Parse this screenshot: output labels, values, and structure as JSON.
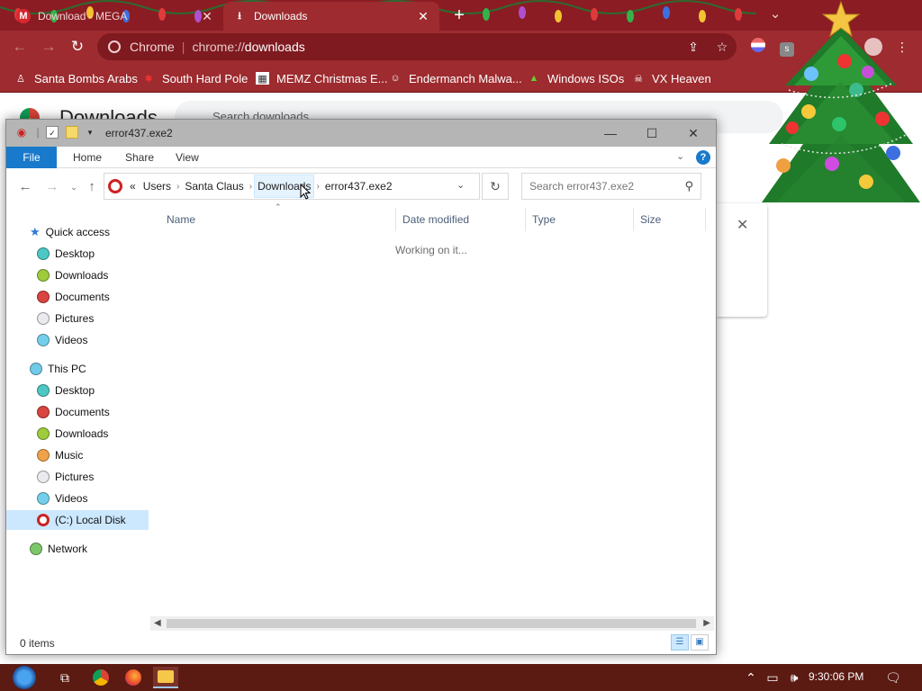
{
  "chrome": {
    "tabs": [
      {
        "title": "Download - MEGA",
        "favicon": "M",
        "close": "✕"
      },
      {
        "title": "Downloads",
        "favicon": "⭳",
        "close": "✕"
      }
    ],
    "new_tab": "+",
    "address": {
      "label": "Chrome",
      "separator": "|",
      "url_prefix": "chrome://",
      "url_main": "downloads"
    },
    "bookmarks": [
      "Santa Bombs Arabs",
      "South Hard Pole",
      "MEMZ Christmas E...",
      "Endermanch Malwa...",
      "Windows ISOs",
      "VX Heaven"
    ],
    "page_title": "Downloads",
    "search_placeholder": "Search downloads"
  },
  "explorer": {
    "title": "error437.exe2",
    "ribbon_tabs": [
      "File",
      "Home",
      "Share",
      "View"
    ],
    "breadcrumb": {
      "overflow": "«",
      "items": [
        "Users",
        "Santa Claus",
        "Downloads",
        "error437.exe2"
      ]
    },
    "search_placeholder": "Search error437.exe2",
    "columns": [
      "Name",
      "Date modified",
      "Type",
      "Size"
    ],
    "status_message": "Working on it...",
    "item_count": "0 items",
    "nav": {
      "quick_access": {
        "label": "Quick access",
        "items": [
          "Desktop",
          "Downloads",
          "Documents",
          "Pictures",
          "Videos"
        ]
      },
      "this_pc": {
        "label": "This PC",
        "items": [
          "Desktop",
          "Documents",
          "Downloads",
          "Music",
          "Pictures",
          "Videos",
          "(C:) Local Disk"
        ]
      },
      "network": "Network"
    }
  },
  "taskbar": {
    "clock": "9:30:06 PM"
  },
  "colors": {
    "chrome_frame": "#9d2b2f",
    "tabstrip": "#8b1c24",
    "explorer_titlebar": "#b5b5b5",
    "ribbon_file": "#1979ca",
    "taskbar": "#5b1a12",
    "selection": "#cce8ff"
  }
}
